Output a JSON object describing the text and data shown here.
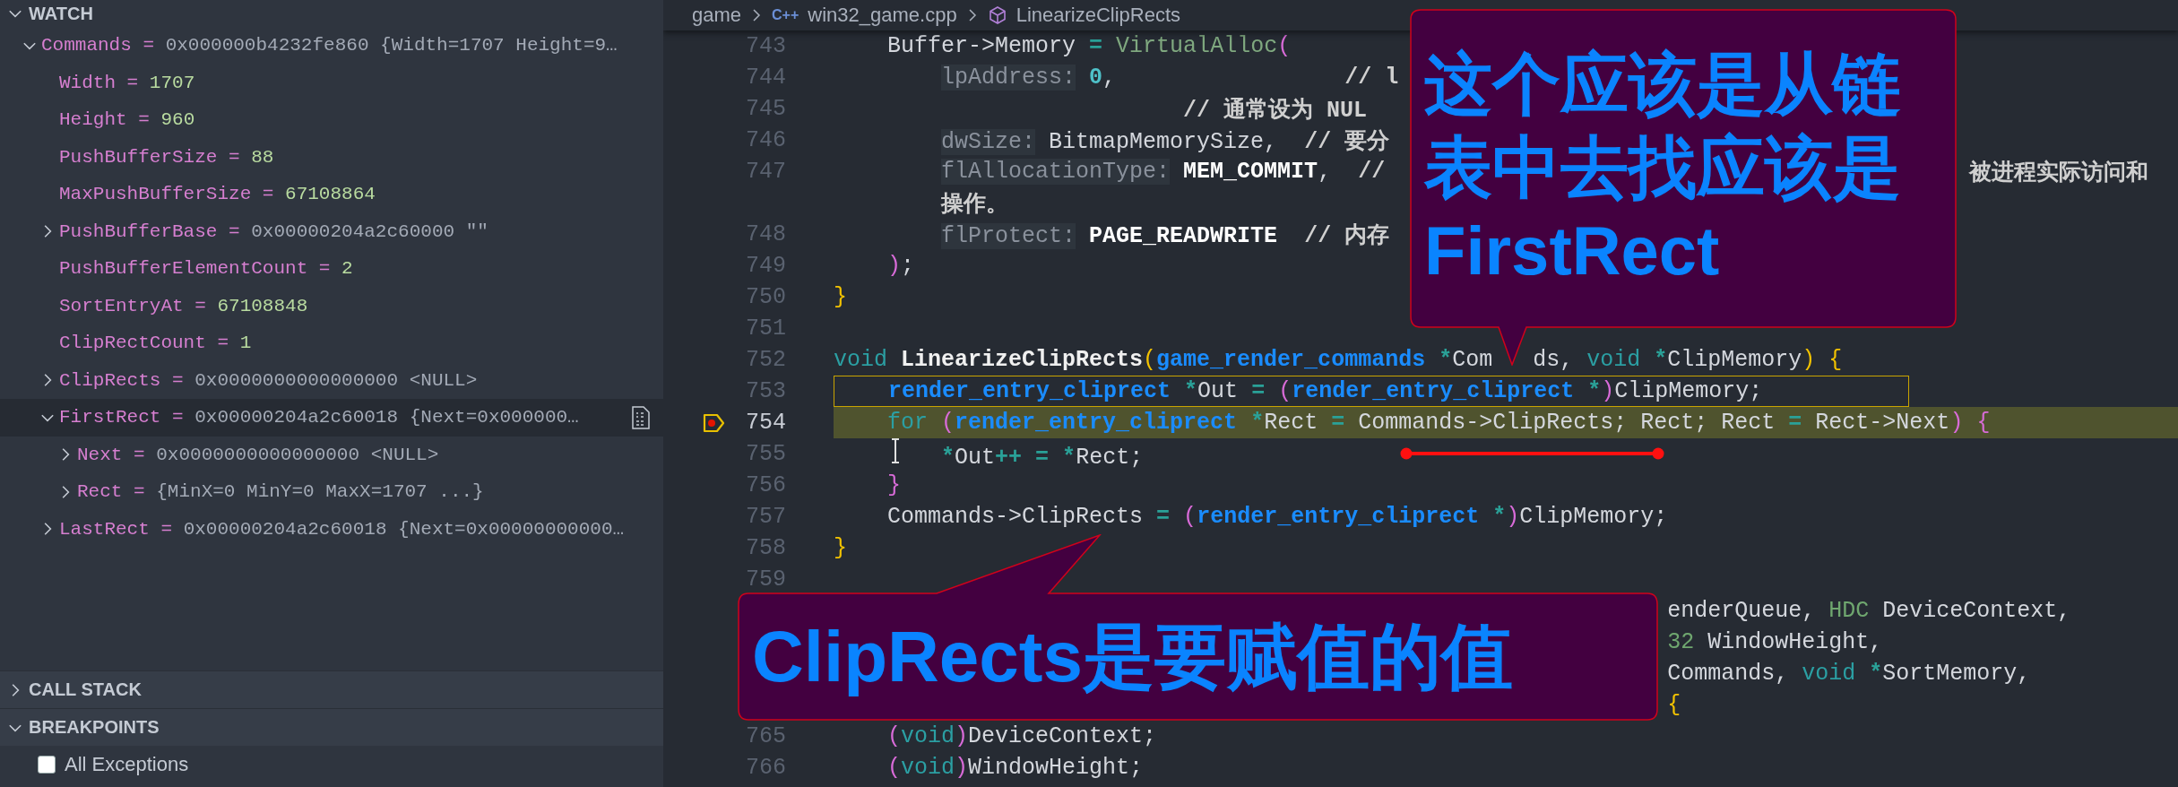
{
  "sidebar": {
    "watch": {
      "title": "WATCH",
      "expanded": true,
      "items": [
        {
          "name": "Commands",
          "operator": "=",
          "value": "0x000000b4232fe860 {Width=1707 Height=9…",
          "kind": "pointer",
          "expanded": true,
          "selected": false,
          "children": [
            {
              "name": "Width",
              "operator": "=",
              "value": "1707",
              "kind": "number",
              "selected": false
            },
            {
              "name": "Height",
              "operator": "=",
              "value": "960",
              "kind": "number",
              "selected": false
            },
            {
              "name": "PushBufferSize",
              "operator": "=",
              "value": "88",
              "kind": "number",
              "selected": false
            },
            {
              "name": "MaxPushBufferSize",
              "operator": "=",
              "value": "67108864",
              "kind": "number",
              "selected": false
            },
            {
              "name": "PushBufferBase",
              "operator": "=",
              "value": "0x00000204a2c60000 \"\"",
              "kind": "pointer",
              "expanded": false,
              "selected": false
            },
            {
              "name": "PushBufferElementCount",
              "operator": "=",
              "value": "2",
              "kind": "number",
              "selected": false
            },
            {
              "name": "SortEntryAt",
              "operator": "=",
              "value": "67108848",
              "kind": "number",
              "selected": false
            },
            {
              "name": "ClipRectCount",
              "operator": "=",
              "value": "1",
              "kind": "number",
              "selected": false
            },
            {
              "name": "ClipRects",
              "operator": "=",
              "value": "0x0000000000000000 <NULL>",
              "kind": "pointer",
              "expanded": false,
              "selected": false
            },
            {
              "name": "FirstRect",
              "operator": "=",
              "value": "0x00000204a2c60018 {Next=0x000000…",
              "kind": "pointer",
              "expanded": true,
              "selected": true,
              "children": [
                {
                  "name": "Next",
                  "operator": "=",
                  "value": "0x0000000000000000 <NULL>",
                  "kind": "pointer",
                  "expanded": false,
                  "selected": false
                },
                {
                  "name": "Rect",
                  "operator": "=",
                  "value": "{MinX=0 MinY=0 MaxX=1707 ...}",
                  "kind": "pointer",
                  "expanded": false,
                  "selected": false
                }
              ]
            },
            {
              "name": "LastRect",
              "operator": "=",
              "value": "0x00000204a2c60018 {Next=0x00000000000…",
              "kind": "pointer",
              "expanded": false,
              "selected": false
            }
          ]
        }
      ]
    },
    "call_stack": {
      "title": "CALL STACK",
      "expanded": false
    },
    "breakpoints": {
      "title": "BREAKPOINTS",
      "expanded": true,
      "items": [
        {
          "label": "All Exceptions",
          "checked": false
        }
      ]
    }
  },
  "editor": {
    "breadcrumb": [
      {
        "label": "game",
        "kind": "folder"
      },
      {
        "label": "win32_game.cpp",
        "kind": "file",
        "badge": "C++"
      },
      {
        "label": "LinearizeClipRects",
        "kind": "method"
      }
    ],
    "lines": [
      {
        "num": "743",
        "kind": "code",
        "current": false,
        "outlined": false,
        "breakpoint": false,
        "tokens": [
          {
            "t": "    Buffer->Memory",
            "kind": "p"
          },
          {
            "t": " =",
            "kind": "op"
          },
          {
            "t": " VirtualAlloc",
            "kind": "call"
          },
          {
            "t": "(",
            "kind": "pp"
          }
        ]
      },
      {
        "num": "744",
        "kind": "code",
        "current": false,
        "outlined": false,
        "breakpoint": false,
        "tokens": [
          {
            "t": "        lpAddress:",
            "kind": "hint"
          },
          {
            "t": " 0",
            "kind": "num"
          },
          {
            "t": ",",
            "kind": "p"
          },
          {
            "t": "                 // l",
            "kind": "cm"
          }
        ]
      },
      {
        "num": "745",
        "kind": "code",
        "current": false,
        "outlined": false,
        "breakpoint": false,
        "tokens": [
          {
            "t": "                          // 通常设为 NUL",
            "kind": "cm"
          }
        ]
      },
      {
        "num": "746",
        "kind": "code",
        "current": false,
        "outlined": false,
        "breakpoint": false,
        "tokens": [
          {
            "t": "        dwSize:",
            "kind": "hint"
          },
          {
            "t": " BitmapMemorySize,",
            "kind": "p"
          },
          {
            "t": "  // 要分",
            "kind": "cm"
          }
        ]
      },
      {
        "num": "747",
        "kind": "split-note",
        "current": false,
        "outlined": false,
        "breakpoint": false,
        "tokens": [
          {
            "t": "        flAllocationType:",
            "kind": "hint"
          },
          {
            "t": " MEM_COMMIT",
            "kind": "macro"
          },
          {
            "t": ",",
            "kind": "p"
          },
          {
            "t": "  //",
            "kind": "cm"
          }
        ],
        "after": [
          {
            "t": "被进程实际访问和",
            "kind": "cm"
          }
        ]
      },
      {
        "kind": "wrap",
        "current": false,
        "outlined": false,
        "breakpoint": false,
        "tokens": [
          {
            "t": "        操作。",
            "kind": "cm"
          }
        ]
      },
      {
        "num": "748",
        "kind": "code",
        "current": false,
        "outlined": false,
        "breakpoint": false,
        "tokens": [
          {
            "t": "        flProtect:",
            "kind": "hint"
          },
          {
            "t": " PAGE_READWRITE",
            "kind": "macro"
          },
          {
            "t": "  // 内存",
            "kind": "cm"
          }
        ]
      },
      {
        "num": "749",
        "kind": "code",
        "current": false,
        "outlined": false,
        "breakpoint": false,
        "tokens": [
          {
            "t": "    )",
            "kind": "pp"
          },
          {
            "t": ";",
            "kind": "p"
          }
        ]
      },
      {
        "num": "750",
        "kind": "code",
        "current": false,
        "outlined": false,
        "breakpoint": false,
        "tokens": [
          {
            "t": "}",
            "kind": "py"
          }
        ]
      },
      {
        "num": "751",
        "kind": "code",
        "current": false,
        "outlined": false,
        "breakpoint": false
      },
      {
        "num": "752",
        "kind": "split-tail",
        "current": false,
        "outlined": false,
        "breakpoint": false,
        "tokens": [
          {
            "t": "void",
            "kind": "kw"
          },
          {
            "t": " LinearizeClipRects",
            "kind": "fn"
          },
          {
            "t": "(",
            "kind": "py"
          },
          {
            "t": "game_render_commands",
            "kind": "type"
          },
          {
            "t": " *",
            "kind": "op"
          },
          {
            "t": "Com",
            "kind": "p"
          }
        ],
        "after": [
          {
            "t": "ds,",
            "kind": "p"
          },
          {
            "t": " void",
            "kind": "kw"
          },
          {
            "t": " *",
            "kind": "op"
          },
          {
            "t": "ClipMemory",
            "kind": "p"
          },
          {
            "t": ")",
            "kind": "py"
          },
          {
            "t": " {",
            "kind": "py"
          }
        ]
      },
      {
        "num": "753",
        "kind": "code",
        "current": false,
        "outlined": true,
        "breakpoint": false,
        "tokens": [
          {
            "t": "    render_entry_cliprect",
            "kind": "type"
          },
          {
            "t": " *",
            "kind": "op"
          },
          {
            "t": "Out",
            "kind": "p"
          },
          {
            "t": " =",
            "kind": "op"
          },
          {
            "t": " (",
            "kind": "pp"
          },
          {
            "t": "render_entry_cliprect",
            "kind": "type"
          },
          {
            "t": " *",
            "kind": "op"
          },
          {
            "t": ")",
            "kind": "pp"
          },
          {
            "t": "ClipMemory;",
            "kind": "p"
          }
        ]
      },
      {
        "num": "754",
        "kind": "code",
        "current": true,
        "outlined": false,
        "breakpoint": true,
        "tokens": [
          {
            "t": "    for",
            "kind": "kw"
          },
          {
            "t": " (",
            "kind": "pp"
          },
          {
            "t": "render_entry_cliprect",
            "kind": "type"
          },
          {
            "t": " *",
            "kind": "op"
          },
          {
            "t": "Rect",
            "kind": "p"
          },
          {
            "t": " =",
            "kind": "op"
          },
          {
            "t": " Commands->ClipRects; Rect; Rect",
            "kind": "p"
          },
          {
            "t": " =",
            "kind": "op"
          },
          {
            "t": " Rect->Next",
            "kind": "p"
          },
          {
            "t": ")",
            "kind": "pp"
          },
          {
            "t": " {",
            "kind": "pp"
          }
        ]
      },
      {
        "num": "755",
        "kind": "code",
        "current": false,
        "outlined": false,
        "breakpoint": false,
        "tokens": [
          {
            "kind": "ibeam"
          },
          {
            "t": "   *",
            "kind": "op"
          },
          {
            "t": "Out",
            "kind": "p"
          },
          {
            "t": "++",
            "kind": "op"
          },
          {
            "t": " =",
            "kind": "op"
          },
          {
            "t": " *",
            "kind": "op"
          },
          {
            "t": "Rect;",
            "kind": "p"
          }
        ]
      },
      {
        "num": "756",
        "kind": "code",
        "current": false,
        "outlined": false,
        "breakpoint": false,
        "tokens": [
          {
            "t": "    }",
            "kind": "pp"
          }
        ]
      },
      {
        "num": "757",
        "kind": "code",
        "current": false,
        "outlined": false,
        "breakpoint": false,
        "tokens": [
          {
            "t": "    Commands->ClipRects",
            "kind": "p"
          },
          {
            "t": " =",
            "kind": "op"
          },
          {
            "t": " (",
            "kind": "pp"
          },
          {
            "t": "render_entry_cliprect",
            "kind": "type"
          },
          {
            "t": " *",
            "kind": "op"
          },
          {
            "t": ")",
            "kind": "pp"
          },
          {
            "t": "ClipMemory;",
            "kind": "p"
          }
        ]
      },
      {
        "num": "758",
        "kind": "code",
        "current": false,
        "outlined": false,
        "breakpoint": false,
        "tokens": [
          {
            "t": "}",
            "kind": "py"
          }
        ]
      },
      {
        "num": "759",
        "kind": "code",
        "current": false,
        "outlined": false,
        "breakpoint": false
      },
      {
        "kind": "behind-box",
        "current": false,
        "outlined": false,
        "breakpoint": false,
        "after": [
          {
            "t": "enderQueue,",
            "kind": "p"
          },
          {
            "t": " HDC",
            "kind": "t2"
          },
          {
            "t": " DeviceContext,",
            "kind": "p"
          }
        ]
      },
      {
        "kind": "behind-box",
        "current": false,
        "outlined": false,
        "breakpoint": false,
        "after": [
          {
            "t": "32",
            "kind": "t2"
          },
          {
            "t": " WindowHeight,",
            "kind": "p"
          }
        ]
      },
      {
        "kind": "behind-box",
        "current": false,
        "outlined": false,
        "breakpoint": false,
        "after": [
          {
            "t": "Commands,",
            "kind": "p"
          },
          {
            "t": " void",
            "kind": "kw"
          },
          {
            "t": " *",
            "kind": "op"
          },
          {
            "t": "SortMemory,",
            "kind": "p"
          }
        ]
      },
      {
        "kind": "behind-box",
        "current": false,
        "outlined": false,
        "breakpoint": false,
        "after": [
          {
            "t": "{",
            "kind": "py"
          }
        ]
      },
      {
        "num": "765",
        "kind": "code",
        "current": false,
        "outlined": false,
        "breakpoint": false,
        "tokens": [
          {
            "t": "    (",
            "kind": "pp"
          },
          {
            "t": "void",
            "kind": "kw"
          },
          {
            "t": ")",
            "kind": "pp"
          },
          {
            "t": "DeviceContext;",
            "kind": "p"
          }
        ]
      },
      {
        "num": "766",
        "kind": "code",
        "current": false,
        "outlined": false,
        "breakpoint": false,
        "tokens": [
          {
            "t": "    (",
            "kind": "pp"
          },
          {
            "t": "void",
            "kind": "kw"
          },
          {
            "t": ")",
            "kind": "pp"
          },
          {
            "t": "WindowHeight;",
            "kind": "p"
          }
        ]
      }
    ]
  },
  "annotations": [
    {
      "kind": "callout",
      "text": "这个应该是从链表中去找应该是FirstRect"
    },
    {
      "kind": "callout",
      "text": "ClipRects是要赋值的值"
    },
    {
      "kind": "underline"
    }
  ]
}
